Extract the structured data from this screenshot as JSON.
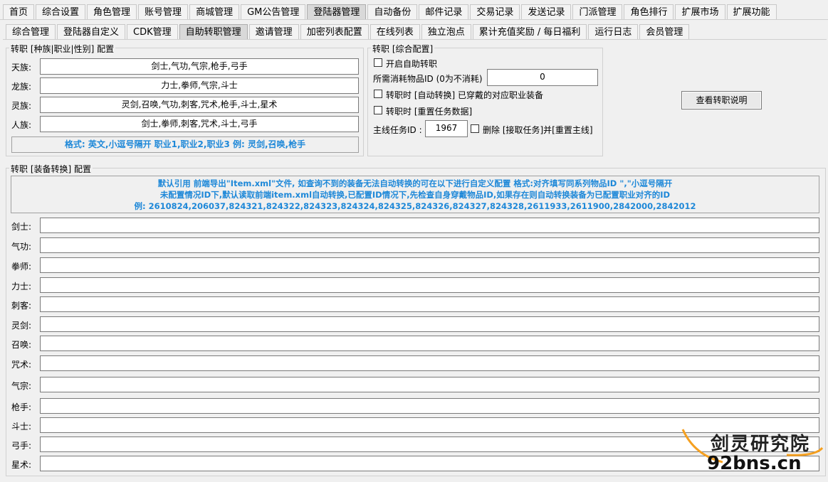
{
  "top_tabs": [
    "首页",
    "综合设置",
    "角色管理",
    "账号管理",
    "商城管理",
    "GM公告管理",
    "登陆器管理",
    "自动备份",
    "邮件记录",
    "交易记录",
    "发送记录",
    "门派管理",
    "角色排行",
    "扩展市场",
    "扩展功能"
  ],
  "sub_tabs": [
    "综合管理",
    "登陆器自定义",
    "CDK管理",
    "自助转职管理",
    "邀请管理",
    "加密列表配置",
    "在线列表",
    "独立泡点",
    "累计充值奖励 / 每日福利",
    "运行日志",
    "会员管理"
  ],
  "race_group": {
    "title": "转职 [种族|职业|性别] 配置",
    "rows": [
      {
        "label": "天族:",
        "value": "剑士,气功,气宗,枪手,弓手"
      },
      {
        "label": "龙族:",
        "value": "力士,拳师,气宗,斗士"
      },
      {
        "label": "灵族:",
        "value": "灵剑,召唤,气功,刺客,咒术,枪手,斗士,星术"
      },
      {
        "label": "人族:",
        "value": "剑士,拳师,刺客,咒术,斗士,弓手"
      }
    ],
    "hint": "格式:  英文,小逗号隔开 职业1,职业2,职业3   例:  灵剑,召唤,枪手"
  },
  "general_group": {
    "title": "转职 [综合配置]",
    "enable_label": "开启自助转职",
    "cost_item_label": "所需消耗物品ID (0为不消耗)",
    "cost_item_value": "0",
    "auto_convert_label": "转职时 [自动转换] 已穿戴的对应职业装备",
    "reset_task_label": "转职时 [重置任务数据]",
    "main_task_label": "主线任务ID :",
    "main_task_value": "1967",
    "delete_label": "删除 [接取任务]并[重置主线]",
    "help_button": "查看转职说明"
  },
  "equip_group": {
    "title": "转职 [装备转换] 配置",
    "hint_lines": [
      "默认引用 前端导出\"Item.xml\"文件, 如查询不到的装备无法自动转换的可在以下进行自定义配置 格式:对齐填写同系列物品ID \",\"小逗号隔开",
      "未配置情况ID下,默认读取前端item.xml自动转换,已配置ID情况下,先检查自身穿戴物品ID,如果存在则自动转换装备为已配置职业对齐的ID",
      "例:  2610824,206037,824321,824322,824323,824324,824325,824326,824327,824328,2611933,2611900,2842000,2842012"
    ],
    "classes": [
      "剑士:",
      "气功:",
      "拳师:",
      "力士:",
      "刺客:",
      "灵剑:",
      "召唤:",
      "咒术:",
      "气宗:",
      "枪手:",
      "斗士:",
      "弓手:",
      "星术:"
    ]
  },
  "watermark": {
    "line1": "剑灵研究院",
    "line2": "92bns.cn"
  }
}
